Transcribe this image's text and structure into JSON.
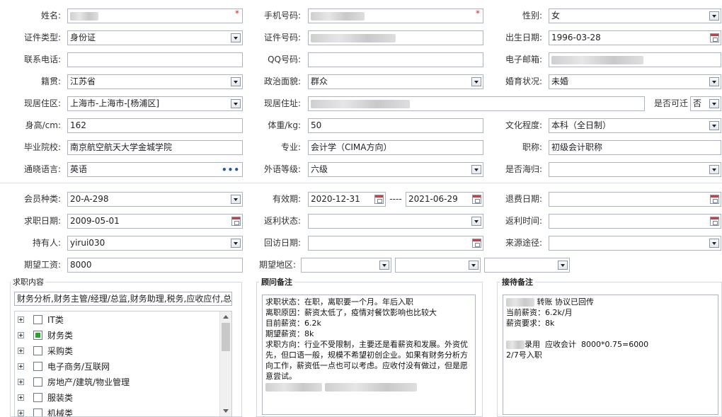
{
  "personal": {
    "name": {
      "label": "姓名:",
      "value": ""
    },
    "mobile": {
      "label": "手机号码:",
      "value": ""
    },
    "gender": {
      "label": "性别:",
      "value": "女"
    },
    "id_type": {
      "label": "证件类型:",
      "value": "身份证"
    },
    "id_number": {
      "label": "证件号码:",
      "value": ""
    },
    "birthdate": {
      "label": "出生日期:",
      "value": "1996-03-28"
    },
    "phone": {
      "label": "联系电话:",
      "value": ""
    },
    "qq": {
      "label": "QQ号码:",
      "value": ""
    },
    "email": {
      "label": "电子邮箱:",
      "value": ""
    },
    "native_place": {
      "label": "籍贯:",
      "value": "江苏省"
    },
    "political_status": {
      "label": "政治面貌:",
      "value": "群众"
    },
    "marital_status": {
      "label": "婚育状况:",
      "value": "未婚"
    },
    "current_region": {
      "label": "现居住区:",
      "value": "上海市-上海市-[杨浦区]"
    },
    "current_address": {
      "label": "现居住址:",
      "value": ""
    },
    "relocatable": {
      "label": "是否可迁",
      "value": "否"
    },
    "height": {
      "label": "身高/cm:",
      "value": "162"
    },
    "weight": {
      "label": "体重/kg:",
      "value": "50"
    },
    "education": {
      "label": "文化程度:",
      "value": "本科（全日制）"
    },
    "school": {
      "label": "毕业院校:",
      "value": "南京航空航天大学金城学院"
    },
    "major": {
      "label": "专业:",
      "value": "会计学（CIMA方向）"
    },
    "title": {
      "label": "职称:",
      "value": "初级会计职称"
    },
    "language": {
      "label": "通晓语言:",
      "value": "英语"
    },
    "foreign_level": {
      "label": "外语等级:",
      "value": "六级"
    },
    "overseas": {
      "label": "是否海归:",
      "value": ""
    }
  },
  "membership": {
    "member_type": {
      "label": "会员种类:",
      "value": "20-A-298"
    },
    "validity": {
      "label": "有效期:",
      "from": "2020-12-31",
      "sep": "----",
      "to": "2021-06-29"
    },
    "refund_date": {
      "label": "退费日期:",
      "value": ""
    },
    "job_date": {
      "label": "求职日期:",
      "value": "2009-05-01"
    },
    "rebate_status": {
      "label": "返利状态:",
      "value": ""
    },
    "rebate_time": {
      "label": "返利时间:",
      "value": ""
    },
    "holder": {
      "label": "持有人:",
      "value": "yirui030"
    },
    "visit_date": {
      "label": "回访日期:",
      "value": ""
    },
    "source": {
      "label": "来源途径:",
      "value": ""
    },
    "expected_salary": {
      "label": "期望工资:",
      "value": "8000"
    },
    "expected_area": {
      "label": "期望地区:",
      "values": [
        "",
        "",
        "",
        ""
      ]
    }
  },
  "job_content": {
    "title": "求职内容",
    "summary": "财务分析,财务主管/经理/总监,财务助理,税务,应收应付,总帐",
    "tree": [
      {
        "label": "IT类",
        "state": "none"
      },
      {
        "label": "财务类",
        "state": "partial"
      },
      {
        "label": "采购类",
        "state": "none"
      },
      {
        "label": "电子商务/互联网",
        "state": "none"
      },
      {
        "label": "房地产/建筑/物业管理",
        "state": "none"
      },
      {
        "label": "服装类",
        "state": "none"
      },
      {
        "label": "机械类",
        "state": "none"
      }
    ]
  },
  "advisor_notes": {
    "title": "顾问备注",
    "lines": [
      "求职状态：在职，离职要一个月。年后入职",
      "离职原因：薪资太低了，疫情对餐饮影响也比较大",
      "目前薪资：6.2k",
      "期望薪资：8k",
      "求职方向：行业不受限制，主要还是看薪资和发展。外资优先，但口语一般，规模不希望初创企业。如果有财务分析方向工作，薪资低一点也可以考虑。应收付没有做过，但是愿意尝试。"
    ]
  },
  "reception_notes": {
    "title": "接待备注",
    "lines": [
      "转账 协议已回传",
      "当前薪资：6.2k/月",
      "薪资要求：8k",
      "",
      "录用  应收会计  8000*0.75=6000",
      "2/7号入职"
    ]
  }
}
